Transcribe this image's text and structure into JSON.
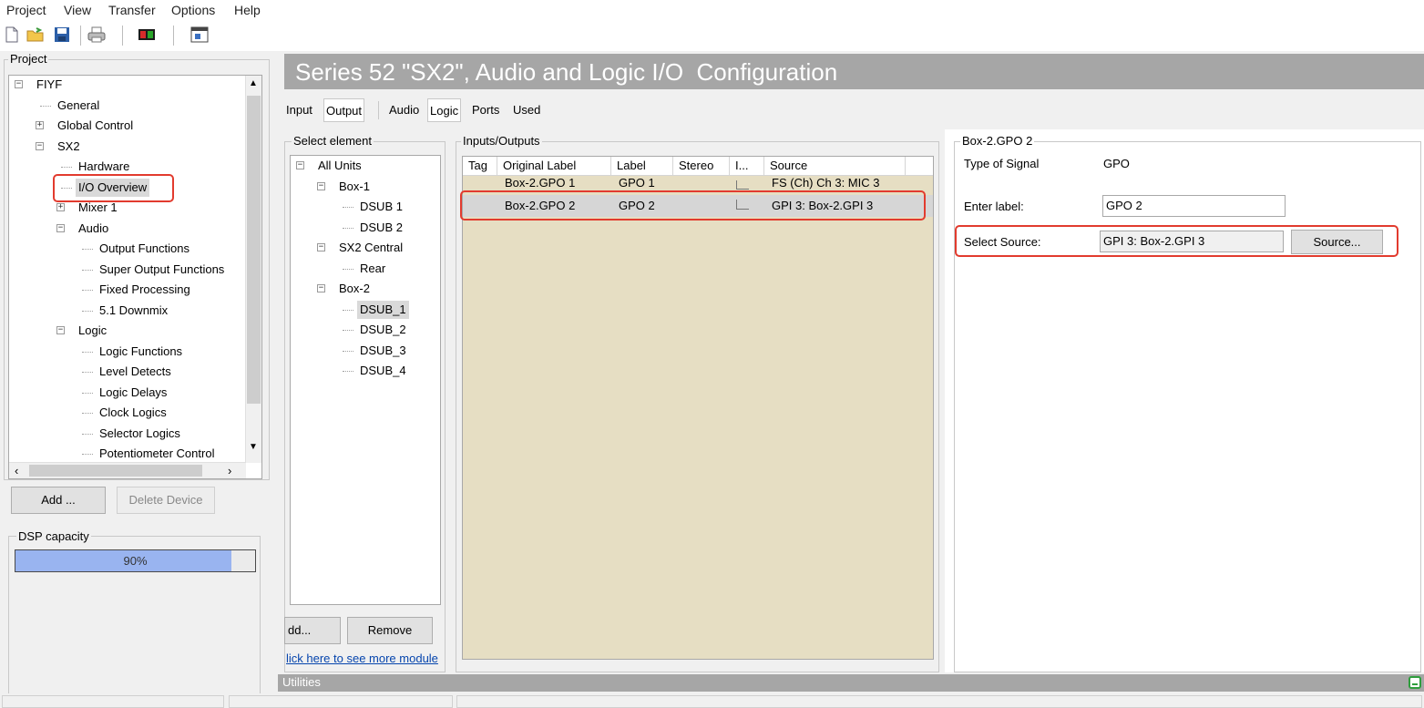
{
  "menu": [
    "Project",
    "View",
    "Transfer",
    "Options",
    "Help"
  ],
  "toolbar_icons": [
    "new-file-icon",
    "open-folder-icon",
    "save-icon",
    "print-icon",
    "device-icon",
    "window-icon"
  ],
  "project_panel": {
    "title": "Project",
    "tree": [
      {
        "label": "FIYF",
        "level": 0,
        "expander": "minus"
      },
      {
        "label": "General",
        "level": 1
      },
      {
        "label": "Global Control",
        "level": 1,
        "expander": "plus"
      },
      {
        "label": "SX2",
        "level": 1,
        "expander": "minus"
      },
      {
        "label": "Hardware",
        "level": 2
      },
      {
        "label": "I/O Overview",
        "level": 2,
        "selected": true
      },
      {
        "label": "Mixer 1",
        "level": 2,
        "expander": "plus"
      },
      {
        "label": "Audio",
        "level": 2,
        "expander": "minus"
      },
      {
        "label": "Output Functions",
        "level": 3
      },
      {
        "label": "Super Output Functions",
        "level": 3
      },
      {
        "label": "Fixed Processing",
        "level": 3
      },
      {
        "label": "5.1 Downmix",
        "level": 3
      },
      {
        "label": "Logic",
        "level": 2,
        "expander": "minus"
      },
      {
        "label": "Logic Functions",
        "level": 3
      },
      {
        "label": "Level Detects",
        "level": 3
      },
      {
        "label": "Logic Delays",
        "level": 3
      },
      {
        "label": "Clock Logics",
        "level": 3
      },
      {
        "label": "Selector Logics",
        "level": 3
      },
      {
        "label": "Potentiometer Control",
        "level": 3
      }
    ],
    "add_button": "Add ...",
    "delete_button": "Delete Device"
  },
  "dsp": {
    "title": "DSP capacity",
    "percent_label": "90%",
    "percent": 90
  },
  "page_title": "Series 52 \"SX2\", Audio and Logic I/O  Configuration",
  "tabs": [
    {
      "label": "Input",
      "selected": false
    },
    {
      "label": "Output",
      "selected": true
    },
    {
      "label": "Audio",
      "selected": false
    },
    {
      "label": "Logic",
      "selected": true
    },
    {
      "label": "Ports",
      "selected": false
    },
    {
      "label": "Used",
      "selected": false
    }
  ],
  "select_element": {
    "title": "Select element",
    "tree": [
      {
        "label": "All Units",
        "level": 0,
        "expander": "minus"
      },
      {
        "label": "Box-1",
        "level": 1,
        "expander": "minus"
      },
      {
        "label": "DSUB 1",
        "level": 2
      },
      {
        "label": "DSUB 2",
        "level": 2
      },
      {
        "label": "SX2 Central",
        "level": 1,
        "expander": "minus"
      },
      {
        "label": "Rear",
        "level": 2
      },
      {
        "label": "Box-2",
        "level": 1,
        "expander": "minus"
      },
      {
        "label": "DSUB_1",
        "level": 2,
        "selected": true
      },
      {
        "label": "DSUB_2",
        "level": 2
      },
      {
        "label": "DSUB_3",
        "level": 2
      },
      {
        "label": "DSUB_4",
        "level": 2
      }
    ],
    "add_button": "dd...",
    "remove_button": "Remove",
    "link": "lick here to see more module"
  },
  "io_panel": {
    "title": "Inputs/Outputs",
    "columns": [
      "Tag",
      "Original Label",
      "Label",
      "Stereo",
      "I...",
      "Source"
    ],
    "rows": [
      {
        "tag": "",
        "original": "Box-2.GPO 1",
        "label": "GPO 1",
        "stereo": "",
        "source": "FS (Ch) Ch 3: MIC 3"
      },
      {
        "tag": "",
        "original": "Box-2.GPO 2",
        "label": "GPO 2",
        "stereo": "",
        "source": "GPI 3: Box-2.GPI 3"
      }
    ]
  },
  "detail": {
    "title": "Box-2.GPO 2",
    "type_label": "Type of Signal",
    "type_value": "GPO",
    "enter_label": "Enter label:",
    "label_value": "GPO 2",
    "select_source_label": "Select Source:",
    "source_value": "GPI 3: Box-2.GPI 3",
    "source_button": "Source..."
  },
  "utilities_label": "Utilities",
  "colors": {
    "accent_red": "#e23b2e",
    "grid_bg": "#e6dec3",
    "title_bar": "#a6a6a6",
    "dsp_fill": "#99b4f0"
  }
}
